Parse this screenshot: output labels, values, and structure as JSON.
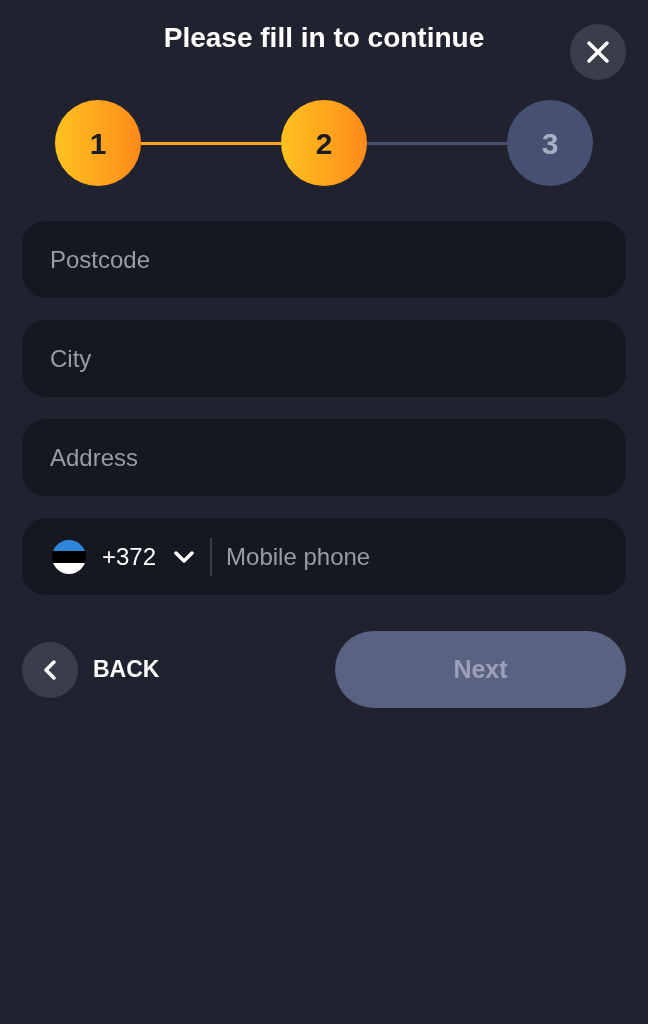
{
  "title": "Please fill in to continue",
  "steps": [
    {
      "label": "1",
      "reached": true
    },
    {
      "label": "2",
      "reached": true
    },
    {
      "label": "3",
      "reached": false
    }
  ],
  "fields": [
    {
      "placeholder": "Postcode"
    },
    {
      "placeholder": "City"
    },
    {
      "placeholder": "Address"
    }
  ],
  "phone": {
    "country_code": "+372",
    "placeholder": "Mobile phone"
  },
  "back_button": {
    "label": "BACK"
  },
  "next_button": {
    "label": "Next",
    "disabled": true
  }
}
